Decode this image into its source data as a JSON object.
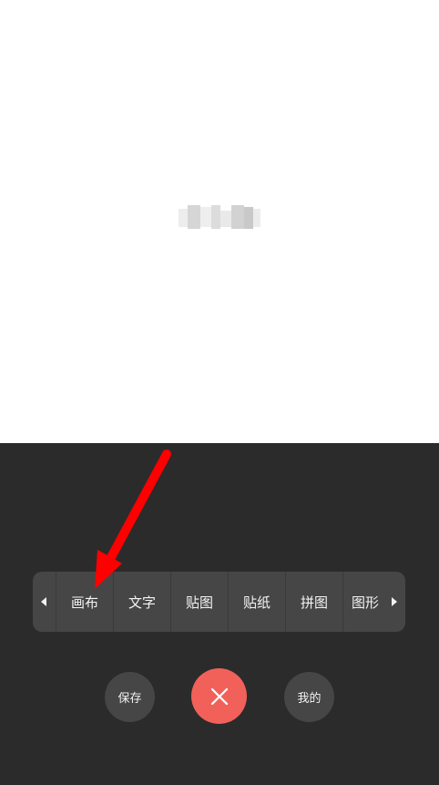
{
  "toolbar": {
    "tabs": [
      {
        "label": "画布"
      },
      {
        "label": "文字"
      },
      {
        "label": "贴图"
      },
      {
        "label": "贴纸"
      },
      {
        "label": "拼图"
      },
      {
        "label": "图形"
      }
    ]
  },
  "actions": {
    "save_label": "保存",
    "mine_label": "我的"
  },
  "colors": {
    "panel_bg": "#2b2b2b",
    "toolbar_bg": "#464646",
    "close_button": "#f1615a",
    "annotation_arrow": "#ff0000"
  }
}
